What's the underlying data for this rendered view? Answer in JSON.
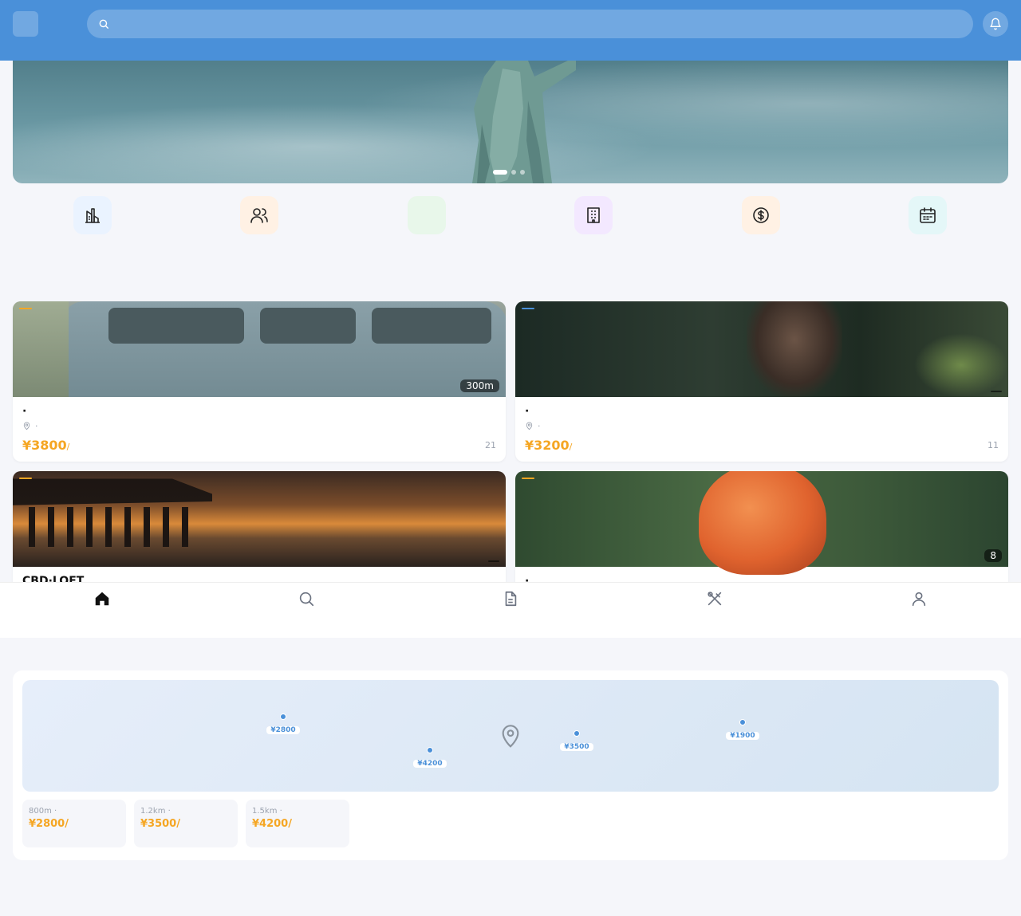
{
  "header": {
    "logo_glyph": "",
    "app_name": "",
    "search_placeholder": ""
  },
  "banner": {
    "slides": 3,
    "active_slide": 1
  },
  "categories": [
    {
      "label": "",
      "icon": "city-icon",
      "bg": "#eaf3ff"
    },
    {
      "label": "",
      "icon": "users-icon",
      "bg": "#fff1e4"
    },
    {
      "label": "",
      "icon": "leaf-icon",
      "bg": "#e8f7ea"
    },
    {
      "label": "",
      "icon": "building-icon",
      "bg": "#f3e8ff"
    },
    {
      "label": "",
      "icon": "dollar-icon",
      "bg": "#fff1e4"
    },
    {
      "label": "",
      "icon": "calendar-icon",
      "bg": "#e4f7f8"
    }
  ],
  "featured": {
    "title": "",
    "more": ""
  },
  "listings": [
    {
      "tag": "",
      "tag_color": "#f5a623",
      "dist": "300m",
      "title": "·",
      "location": "·",
      "price": "¥3800",
      "unit": "/",
      "rooms": "21"
    },
    {
      "tag": "",
      "tag_color": "#4a90d9",
      "dist": "",
      "title": "·",
      "location": "·",
      "price": "¥3200",
      "unit": "/",
      "rooms": "11"
    },
    {
      "tag": "",
      "tag_color": "#f5a623",
      "dist": "",
      "title": "CBD·LOFT",
      "location": "",
      "price": "",
      "unit": "",
      "rooms": ""
    },
    {
      "tag": "",
      "tag_color": "#f5a623",
      "dist": "8",
      "title": "·",
      "location": "",
      "price": "",
      "unit": "",
      "rooms": ""
    }
  ],
  "bottom_nav": [
    {
      "label": "",
      "icon": "home-icon",
      "active": true
    },
    {
      "label": "",
      "icon": "search-icon",
      "active": false
    },
    {
      "label": "",
      "icon": "document-icon",
      "active": false
    },
    {
      "label": "",
      "icon": "tools-icon",
      "active": false
    },
    {
      "label": "",
      "icon": "user-icon",
      "active": false
    }
  ],
  "map_section": {
    "title": "",
    "more": "",
    "pins": [
      {
        "price": "¥2800"
      },
      {
        "price": "¥4200"
      },
      {
        "price": "¥3500"
      },
      {
        "price": "¥1900"
      }
    ],
    "nearby": [
      {
        "name": "",
        "meta": "800m · ",
        "price": "¥2800/"
      },
      {
        "name": "",
        "meta": "1.2km · ",
        "price": "¥3500/"
      },
      {
        "name": "",
        "meta": "1.5km · ",
        "price": "¥4200/"
      }
    ]
  },
  "colors": {
    "primary": "#4a90d9",
    "accent": "#f5a623",
    "background": "#f5f6fa"
  }
}
